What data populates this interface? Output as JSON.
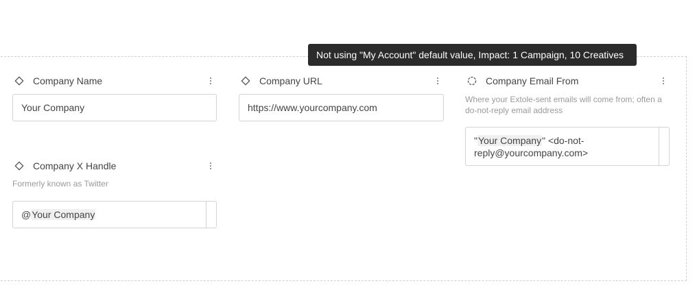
{
  "tooltip": {
    "text": "Not using \"My Account\" default value, Impact: 1 Campaign, 10 Creatives"
  },
  "fields": {
    "company_name": {
      "label": "Company Name",
      "type_icon": "diamond-icon",
      "value": "Your Company"
    },
    "company_url": {
      "label": "Company URL",
      "type_icon": "diamond-icon",
      "value": "https://www.yourcompany.com"
    },
    "company_email_from": {
      "label": "Company Email From",
      "type_icon": "dashed-circle-icon",
      "description": "Where your Extole-sent emails will come from; often a do-not-reply email address",
      "value_prefix": "\"",
      "value_chip": "Your Company",
      "value_suffix": "\" <do-not-reply@yourcompany.com>"
    },
    "company_x_handle": {
      "label": "Company X Handle",
      "type_icon": "diamond-icon",
      "description": "Formerly known as Twitter",
      "value_prefix": "@",
      "value_chip": "Your Company"
    }
  },
  "colors": {
    "tooltip_bg": "#2b2b2b",
    "border": "#d3d3d3",
    "chip_bg": "#f0f0f0"
  }
}
